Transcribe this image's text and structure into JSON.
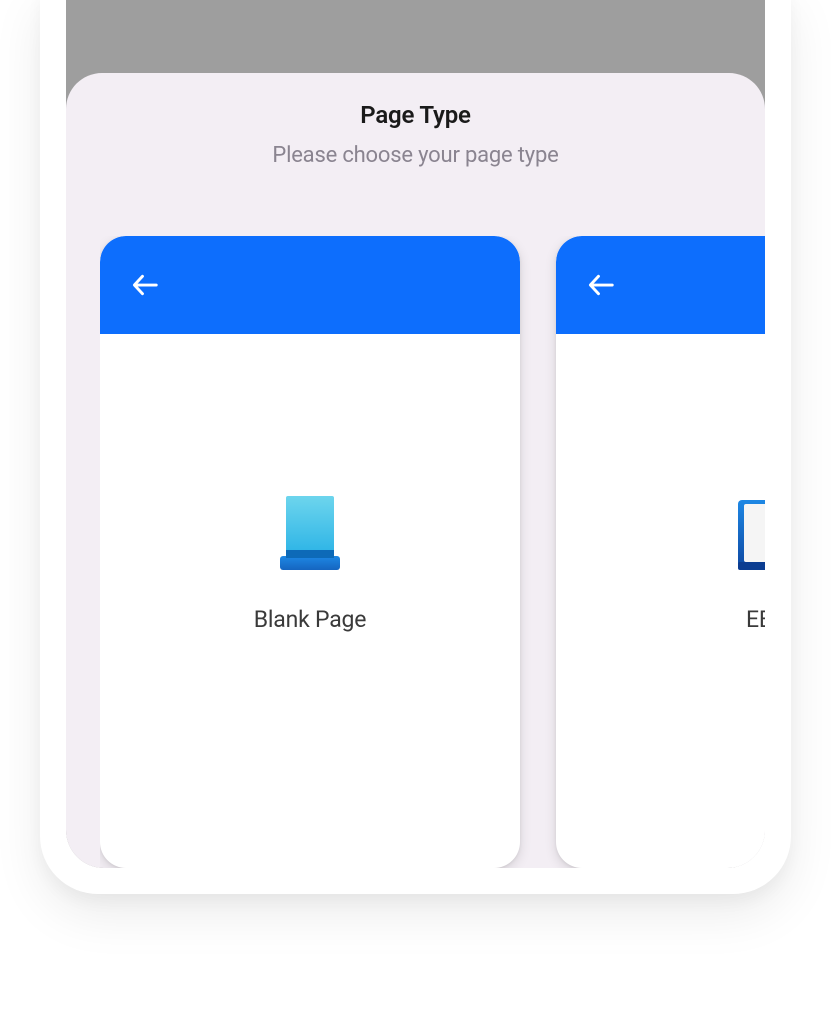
{
  "sheet": {
    "title": "Page Type",
    "subtitle": "Please choose your page type"
  },
  "options": [
    {
      "label": "Blank Page",
      "icon": "blank-page-icon",
      "header_color": "#0d6efd"
    },
    {
      "label": "EBo",
      "icon": "ebook-icon",
      "header_color": "#0d6efd"
    }
  ]
}
